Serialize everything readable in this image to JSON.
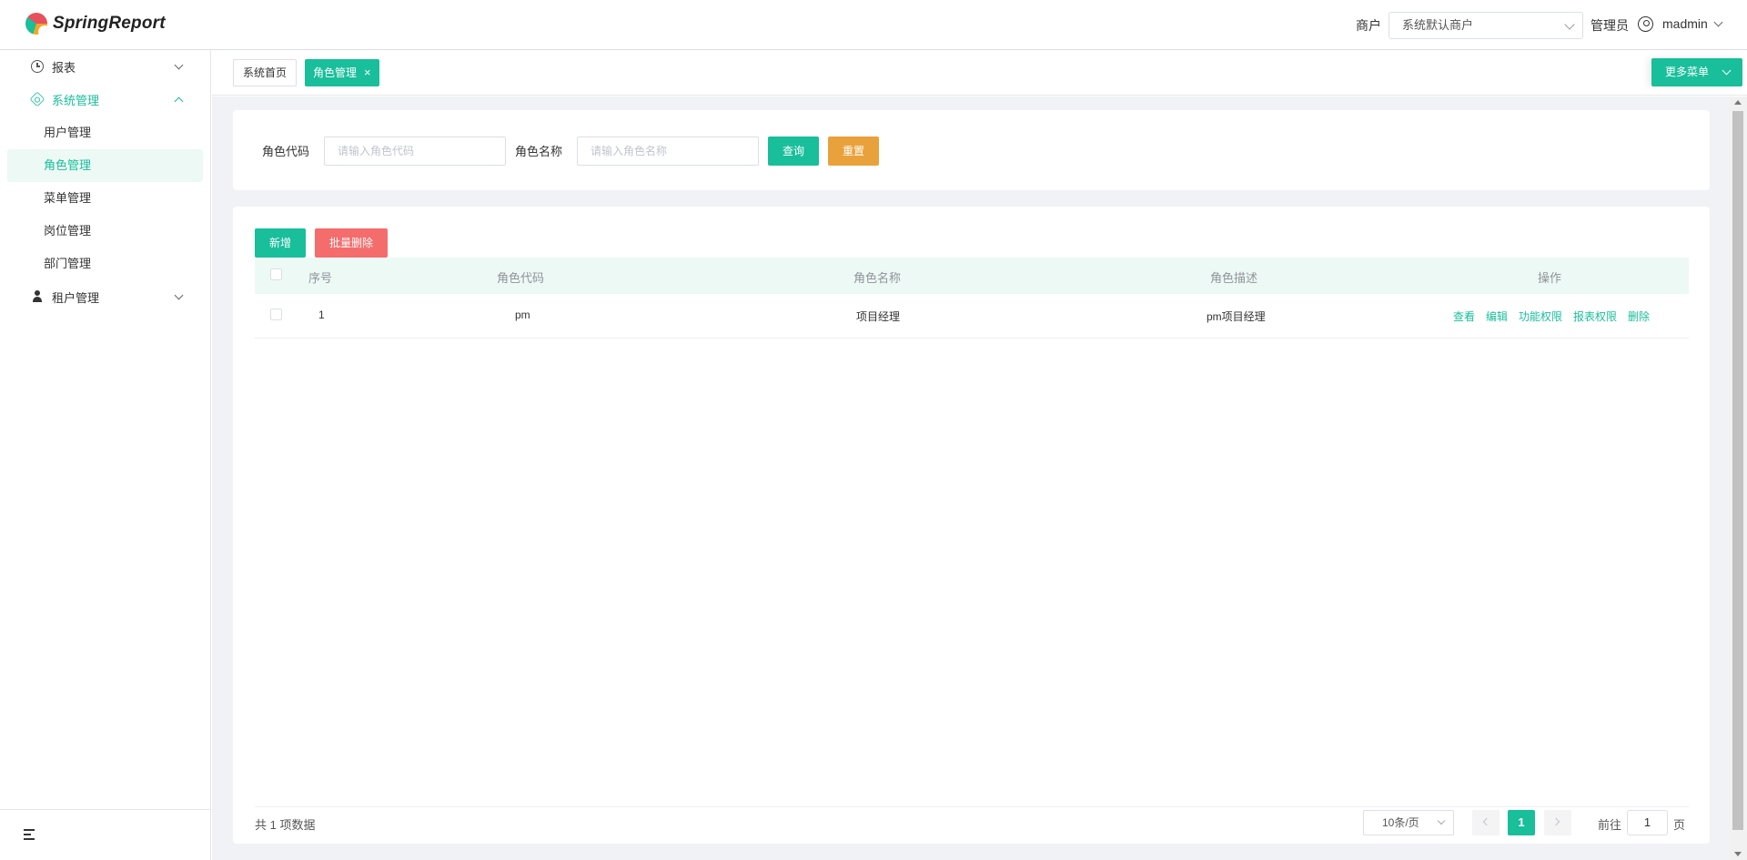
{
  "header": {
    "brand": "SpringReport",
    "tenant_label": "商户",
    "tenant_value": "系统默认商户",
    "role_label": "管理员",
    "username": "madmin"
  },
  "sidebar": {
    "items": [
      {
        "label": "报表",
        "icon": "clock-icon",
        "expanded": false
      },
      {
        "label": "系统管理",
        "icon": "gear-icon",
        "expanded": true,
        "children": [
          "用户管理",
          "角色管理",
          "菜单管理",
          "岗位管理",
          "部门管理"
        ],
        "active_child": "角色管理"
      },
      {
        "label": "租户管理",
        "icon": "person-icon",
        "expanded": false
      }
    ]
  },
  "tabs": {
    "home": "系统首页",
    "active": "角色管理",
    "close": "×",
    "more_menu": "更多菜单"
  },
  "search": {
    "code_label": "角色代码",
    "code_placeholder": "请输入角色代码",
    "name_label": "角色名称",
    "name_placeholder": "请输入角色名称",
    "query_button": "查询",
    "reset_button": "重置"
  },
  "toolbar": {
    "add_button": "新增",
    "batch_delete_button": "批量删除"
  },
  "table": {
    "columns": [
      "序号",
      "角色代码",
      "角色名称",
      "角色描述",
      "操作"
    ],
    "rows": [
      {
        "index": "1",
        "code": "pm",
        "name": "项目经理",
        "desc": "pm项目经理",
        "actions": [
          "查看",
          "编辑",
          "功能权限",
          "报表权限",
          "删除"
        ]
      }
    ]
  },
  "pagination": {
    "total_text": "共 1 项数据",
    "page_size": "10条/页",
    "current_page": "1",
    "goto_prefix": "前往",
    "goto_value": "1",
    "goto_suffix": "页"
  },
  "colors": {
    "primary": "#19be9b",
    "warning": "#e9a23b",
    "danger": "#f56c6c"
  }
}
